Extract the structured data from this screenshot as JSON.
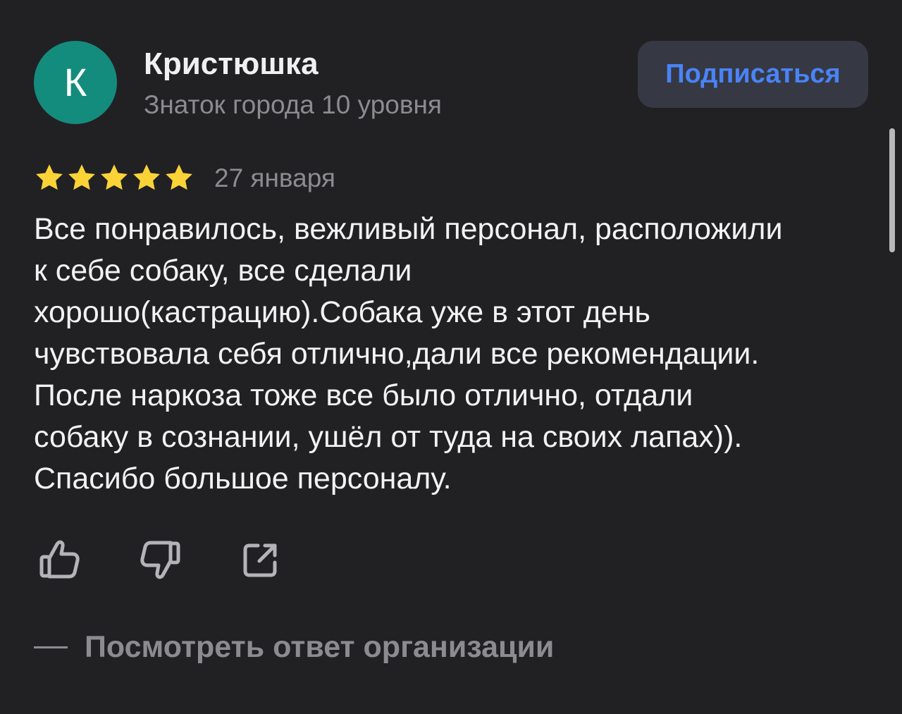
{
  "author": {
    "initial": "К",
    "name": "Кристюшка",
    "level": "Знаток города 10 уровня",
    "avatar_color": "#148c7d"
  },
  "subscribe_button": {
    "label": "Подписаться",
    "color": "#4a83f7"
  },
  "review": {
    "rating": 5,
    "rating_max": 5,
    "star_color": "#fcd337",
    "date": "27 января",
    "lines": [
      "Все понравилось, вежливый персонал, расположили",
      "к себе собаку, все сделали",
      "хорошо(кастрацию).Собака уже в этот день",
      "чувствовала себя отлично,дали все рекомендации.",
      "После наркоза тоже все было отлично, отдали",
      "собаку в сознании, ушёл от туда на своих лапах)).",
      "Спасибо большое персоналу."
    ]
  },
  "actions": {
    "like_icon": "thumbs-up-icon",
    "dislike_icon": "thumbs-down-icon",
    "share_icon": "share-icon"
  },
  "organization_response": {
    "label": "Посмотреть ответ организации"
  }
}
